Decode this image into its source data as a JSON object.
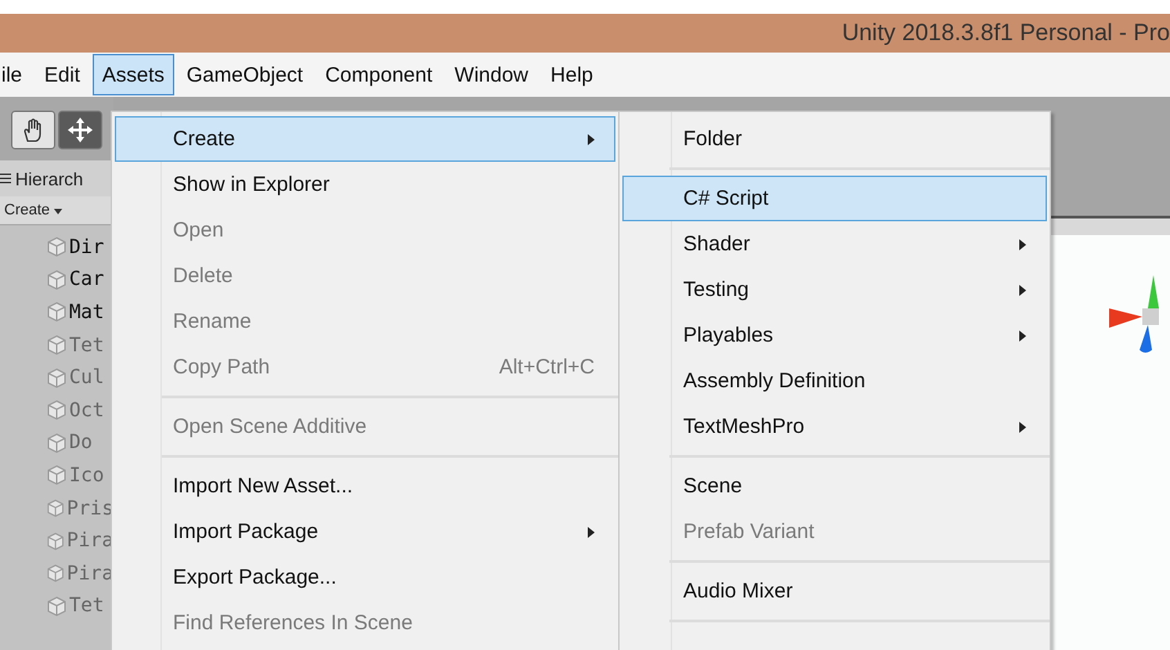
{
  "window": {
    "title": "Unity 2018.3.8f1 Personal - Pro"
  },
  "menubar": [
    {
      "label": "ile",
      "selected": false
    },
    {
      "label": "Edit",
      "selected": false
    },
    {
      "label": "Assets",
      "selected": true
    },
    {
      "label": "GameObject",
      "selected": false
    },
    {
      "label": "Component",
      "selected": false
    },
    {
      "label": "Window",
      "selected": false
    },
    {
      "label": "Help",
      "selected": false
    }
  ],
  "hierarchy": {
    "title": "Hierarch",
    "create": "Create",
    "items": [
      {
        "name": "Dir",
        "active": true
      },
      {
        "name": "Car",
        "active": true
      },
      {
        "name": "Mat",
        "active": true
      },
      {
        "name": "Tet",
        "active": false
      },
      {
        "name": "Cul",
        "active": false
      },
      {
        "name": "Oct",
        "active": false
      },
      {
        "name": "Do",
        "active": false
      },
      {
        "name": "Ico",
        "active": false
      },
      {
        "name": "Pris",
        "active": false
      },
      {
        "name": "Pira",
        "active": false
      },
      {
        "name": "Pira",
        "active": false
      },
      {
        "name": "Tet",
        "active": false
      }
    ]
  },
  "assets_menu": [
    {
      "kind": "item",
      "label": "Create",
      "selected": true,
      "disabled": false,
      "submenu": true
    },
    {
      "kind": "item",
      "label": "Show in Explorer",
      "selected": false,
      "disabled": false,
      "submenu": false
    },
    {
      "kind": "item",
      "label": "Open",
      "selected": false,
      "disabled": true,
      "submenu": false
    },
    {
      "kind": "item",
      "label": "Delete",
      "selected": false,
      "disabled": true,
      "submenu": false
    },
    {
      "kind": "item",
      "label": "Rename",
      "selected": false,
      "disabled": true,
      "submenu": false
    },
    {
      "kind": "item",
      "label": "Copy Path",
      "selected": false,
      "disabled": true,
      "submenu": false,
      "shortcut": "Alt+Ctrl+C"
    },
    {
      "kind": "separator"
    },
    {
      "kind": "item",
      "label": "Open Scene Additive",
      "selected": false,
      "disabled": true,
      "submenu": false
    },
    {
      "kind": "separator"
    },
    {
      "kind": "item",
      "label": "Import New Asset...",
      "selected": false,
      "disabled": false,
      "submenu": false
    },
    {
      "kind": "item",
      "label": "Import Package",
      "selected": false,
      "disabled": false,
      "submenu": true
    },
    {
      "kind": "item",
      "label": "Export Package...",
      "selected": false,
      "disabled": false,
      "submenu": false
    },
    {
      "kind": "item",
      "label": "Find References In Scene",
      "selected": false,
      "disabled": true,
      "submenu": false
    }
  ],
  "create_submenu": [
    {
      "kind": "item",
      "label": "Folder",
      "selected": false,
      "disabled": false,
      "submenu": false
    },
    {
      "kind": "separator"
    },
    {
      "kind": "item",
      "label": "C# Script",
      "selected": true,
      "disabled": false,
      "submenu": false
    },
    {
      "kind": "item",
      "label": "Shader",
      "selected": false,
      "disabled": false,
      "submenu": true
    },
    {
      "kind": "item",
      "label": "Testing",
      "selected": false,
      "disabled": false,
      "submenu": true
    },
    {
      "kind": "item",
      "label": "Playables",
      "selected": false,
      "disabled": false,
      "submenu": true
    },
    {
      "kind": "item",
      "label": "Assembly Definition",
      "selected": false,
      "disabled": false,
      "submenu": false
    },
    {
      "kind": "item",
      "label": "TextMeshPro",
      "selected": false,
      "disabled": false,
      "submenu": true
    },
    {
      "kind": "separator"
    },
    {
      "kind": "item",
      "label": "Scene",
      "selected": false,
      "disabled": false,
      "submenu": false
    },
    {
      "kind": "item",
      "label": "Prefab Variant",
      "selected": false,
      "disabled": true,
      "submenu": false
    },
    {
      "kind": "separator"
    },
    {
      "kind": "item",
      "label": "Audio Mixer",
      "selected": false,
      "disabled": false,
      "submenu": false
    },
    {
      "kind": "separator"
    }
  ]
}
